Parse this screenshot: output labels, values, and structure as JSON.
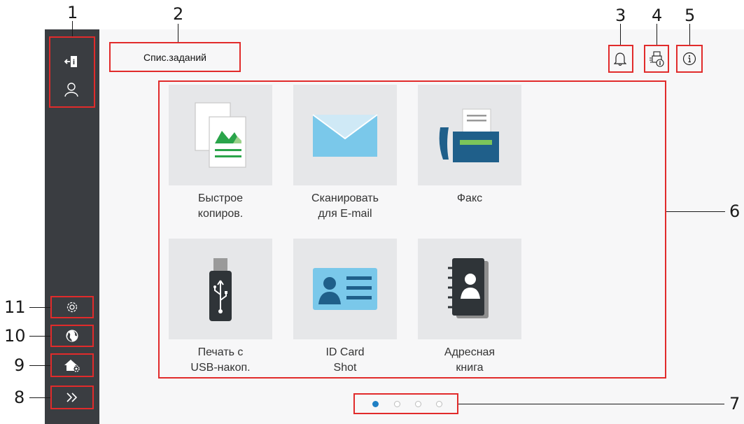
{
  "callouts": [
    "1",
    "2",
    "3",
    "4",
    "5",
    "6",
    "7",
    "8",
    "9",
    "10",
    "11"
  ],
  "header": {
    "job_list_label": "Спис.заданий"
  },
  "tiles": [
    {
      "label": "Быстрое\nкопиров.",
      "icon": "copy-icon"
    },
    {
      "label": "Сканировать\nдля E-mail",
      "icon": "envelope-icon"
    },
    {
      "label": "Факс",
      "icon": "fax-icon"
    },
    {
      "label": "Печать с\nUSB-накоп.",
      "icon": "usb-icon"
    },
    {
      "label": "ID Card\nShot",
      "icon": "id-card-icon"
    },
    {
      "label": "Адресная\nкнига",
      "icon": "address-book-icon"
    }
  ],
  "pagination": {
    "pages": 4,
    "current": 1
  },
  "colors": {
    "sidebar": "#3a3d41",
    "callout_box": "#e12b2b",
    "tile_bg": "#e6e7e9",
    "active_dot": "#1f7fc4"
  },
  "icons": [
    "logout-icon",
    "user-icon",
    "bell-icon",
    "device-info-icon",
    "info-icon",
    "settings-icon",
    "globe-icon",
    "home-settings-icon",
    "chevron-right-icon"
  ]
}
